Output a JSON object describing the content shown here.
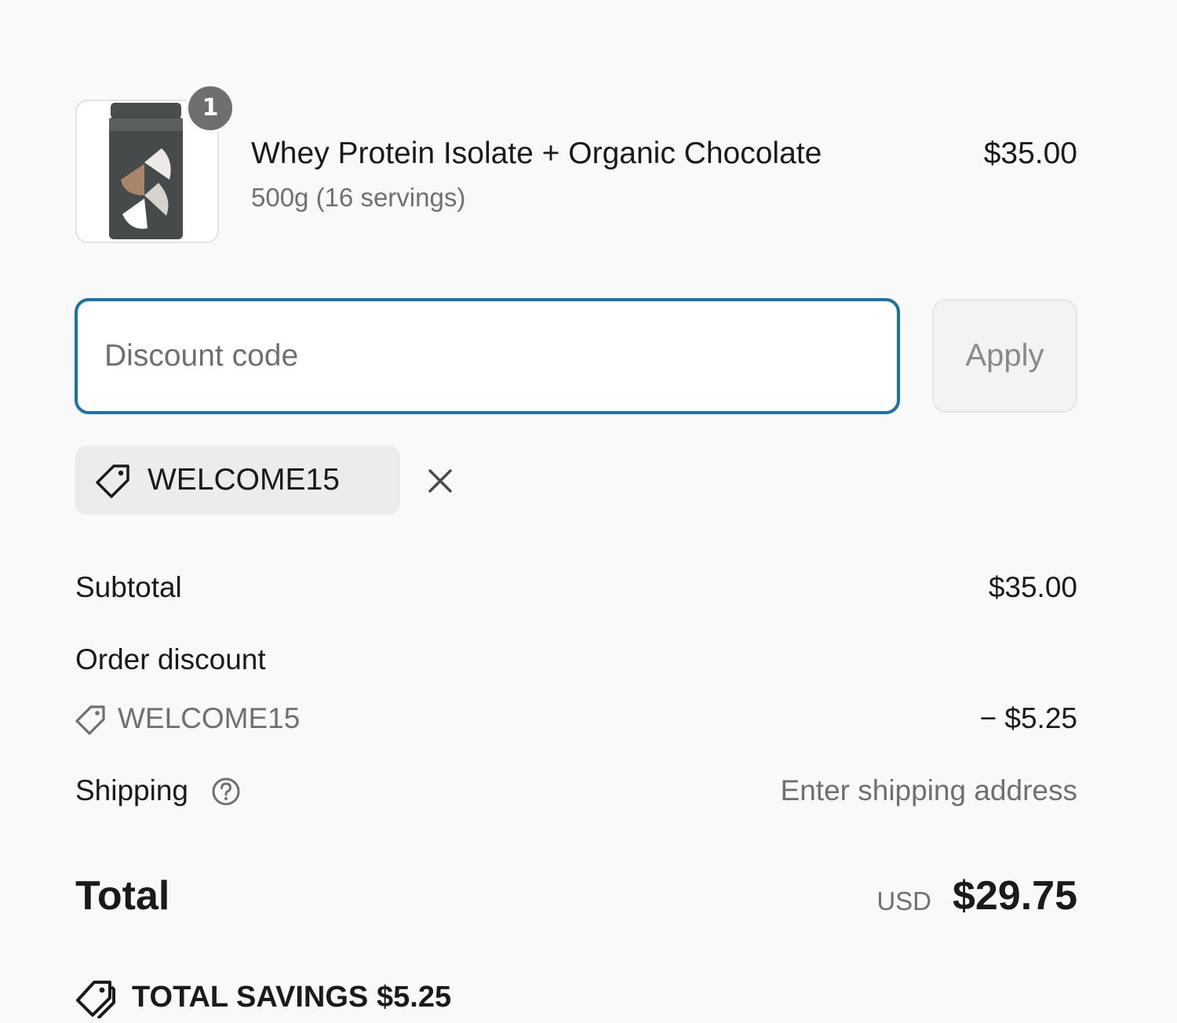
{
  "product": {
    "name": "Whey Protein Isolate + Organic Chocolate",
    "variant": "500g (16 servings)",
    "price": "$35.00",
    "quantity": "1",
    "image_icon": "protein-jar-image"
  },
  "discount": {
    "placeholder": "Discount code",
    "value": "",
    "apply_label": "Apply",
    "applied_code": "WELCOME15"
  },
  "summary": {
    "subtotal_label": "Subtotal",
    "subtotal_value": "$35.00",
    "order_discount_label": "Order discount",
    "order_discount_code": "WELCOME15",
    "order_discount_value": "− $5.25",
    "shipping_label": "Shipping",
    "shipping_value": "Enter shipping address",
    "total_label": "Total",
    "total_currency": "USD",
    "total_value": "$29.75",
    "savings_label": "TOTAL SAVINGS",
    "savings_value": "$5.25"
  },
  "colors": {
    "background": "#f9f9f9",
    "input_focus_border": "#1773b0",
    "muted_text": "#707070",
    "badge": "#6f6f6f"
  }
}
